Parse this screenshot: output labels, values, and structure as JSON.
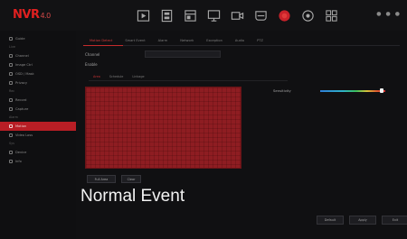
{
  "app": {
    "logo": "NVR",
    "logo_sub": "4.0"
  },
  "topbar": {
    "icons": [
      "play-icon",
      "playback-icon",
      "file-icon",
      "monitor-icon",
      "camera-icon",
      "storage-icon",
      "record-icon",
      "network-icon",
      "apps-icon"
    ],
    "accent": "#e02020",
    "right": [
      "",
      "",
      ""
    ]
  },
  "sidebar": {
    "items": [
      {
        "label": "Guide",
        "type": "item"
      },
      {
        "label": "Live",
        "type": "group"
      },
      {
        "label": "Channel",
        "type": "item"
      },
      {
        "label": "Image Ctrl",
        "type": "item"
      },
      {
        "label": "OSD / Mask",
        "type": "item"
      },
      {
        "label": "Privacy",
        "type": "item"
      },
      {
        "label": "Rec",
        "type": "group"
      },
      {
        "label": "Record",
        "type": "item"
      },
      {
        "label": "Capture",
        "type": "item"
      },
      {
        "label": "Alarm",
        "type": "group"
      },
      {
        "label": "Motion",
        "type": "item",
        "active": true
      },
      {
        "label": "Video Loss",
        "type": "item"
      },
      {
        "label": "Sys",
        "type": "group"
      },
      {
        "label": "Device",
        "type": "item"
      },
      {
        "label": "Info",
        "type": "item"
      }
    ]
  },
  "main": {
    "tabs": [
      {
        "label": "Motion Detect",
        "active": true
      },
      {
        "label": "Smart Event",
        "active": false
      },
      {
        "label": "Alarm",
        "active": false
      },
      {
        "label": "Network",
        "active": false
      },
      {
        "label": "Exception",
        "active": false
      },
      {
        "label": "Audio",
        "active": false
      },
      {
        "label": "PTZ",
        "active": false
      }
    ],
    "channel_label": "Channel",
    "enable_label": "Enable",
    "subtabs": [
      {
        "label": "Area",
        "active": true
      },
      {
        "label": "Schedule",
        "active": false
      },
      {
        "label": "Linkage",
        "active": false
      }
    ],
    "sensitivity_label": "Sensitivity",
    "sensitivity_level": 0.95,
    "grid_color": "#8e1d22",
    "select_all_label": "Full Area",
    "clear_label": "Clear",
    "caption": "Normal Event",
    "footer": [
      "Default",
      "Apply",
      "Exit"
    ]
  }
}
